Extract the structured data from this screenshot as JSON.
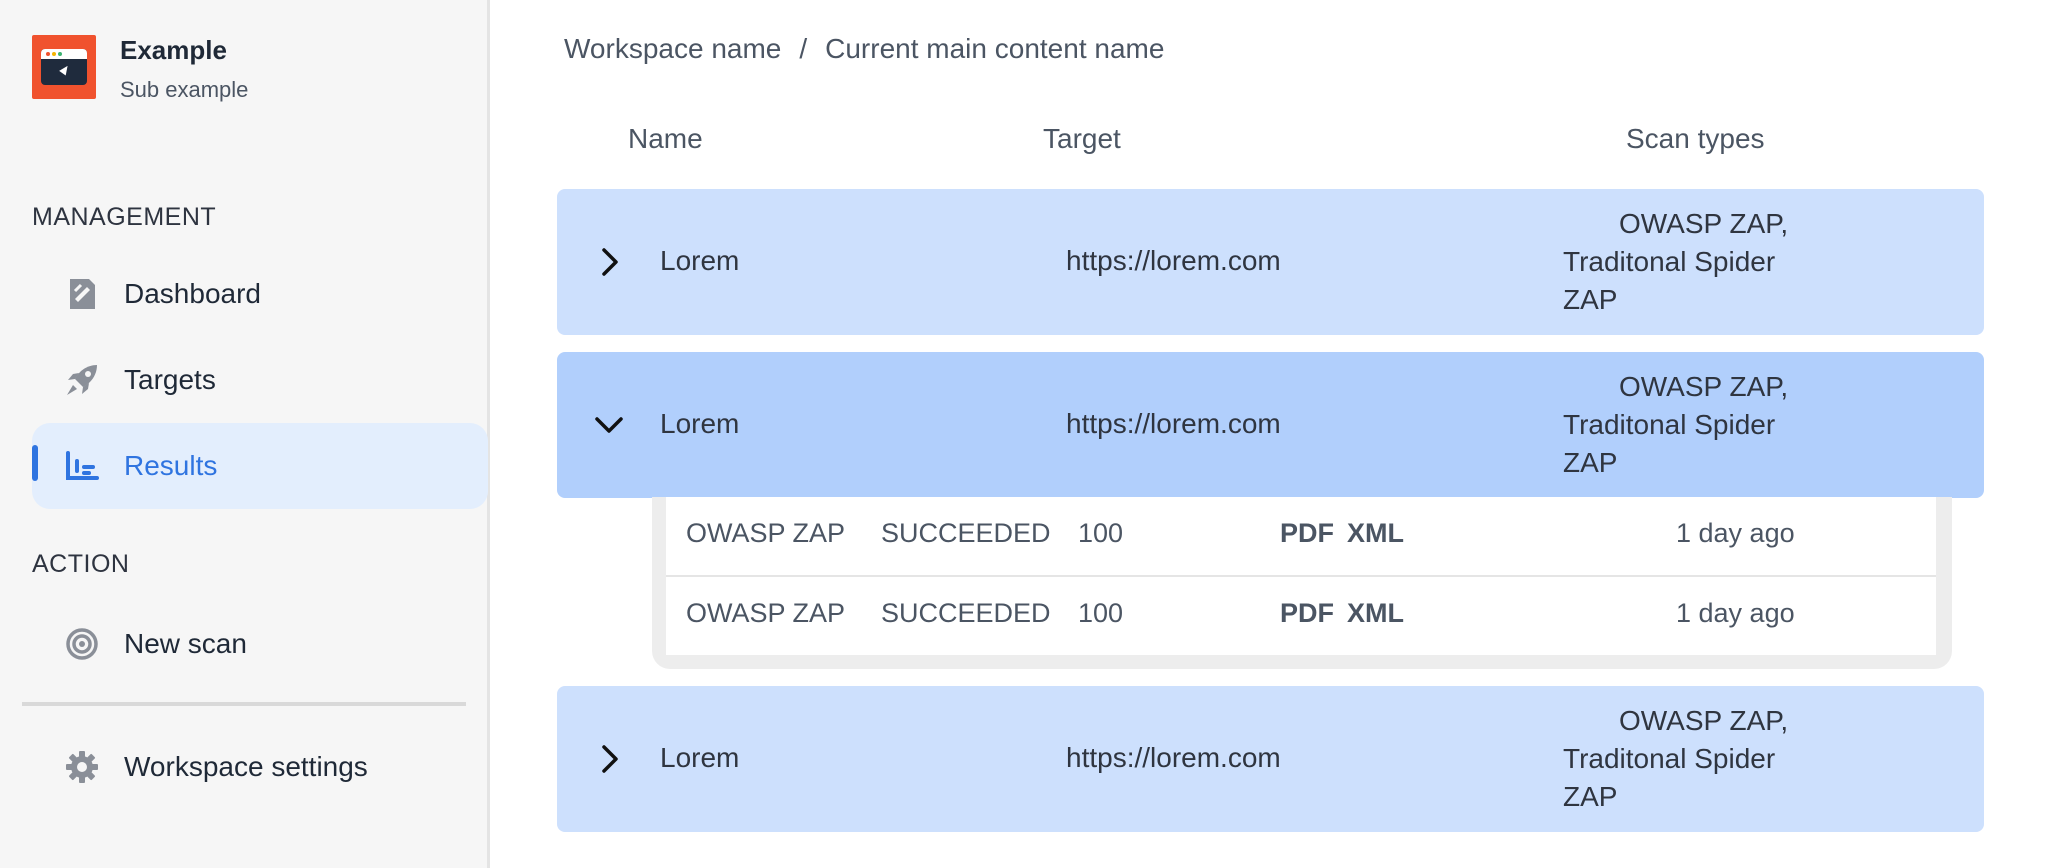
{
  "brand": {
    "title": "Example",
    "subtitle": "Sub example",
    "accent": "#f0522e"
  },
  "sidebar": {
    "management_label": "MANAGEMENT",
    "action_label": "ACTION",
    "items": [
      {
        "label": "Dashboard",
        "icon": "dashboard-icon"
      },
      {
        "label": "Targets",
        "icon": "rocket-icon"
      },
      {
        "label": "Results",
        "icon": "bar-chart-icon",
        "active": true
      },
      {
        "label": "New scan",
        "icon": "target-icon"
      },
      {
        "label": "Workspace settings",
        "icon": "gear-icon"
      }
    ]
  },
  "breadcrumb": {
    "workspace": "Workspace name",
    "separator": "/",
    "current": "Current main content name"
  },
  "table": {
    "headers": {
      "name": "Name",
      "target": "Target",
      "scan_types": "Scan types"
    },
    "rows": [
      {
        "name": "Lorem",
        "target": "https://lorem.com",
        "scan_types": [
          "OWASP ZAP,",
          "Traditonal Spider",
          "ZAP"
        ],
        "expanded": false
      },
      {
        "name": "Lorem",
        "target": "https://lorem.com",
        "scan_types": [
          "OWASP ZAP,",
          "Traditonal Spider",
          "ZAP"
        ],
        "expanded": true
      },
      {
        "name": "Lorem",
        "target": "https://lorem.com",
        "scan_types": [
          "OWASP ZAP,",
          "Traditonal Spider",
          "ZAP"
        ],
        "expanded": false
      }
    ],
    "sub_rows": [
      {
        "scanner": "OWASP ZAP",
        "status": "SUCCEEDED",
        "score": "100",
        "pdf": "PDF",
        "xml": "XML",
        "time": "1 day ago"
      },
      {
        "scanner": "OWASP ZAP",
        "status": "SUCCEEDED",
        "score": "100",
        "pdf": "PDF",
        "xml": "XML",
        "time": "1 day ago"
      }
    ]
  },
  "colors": {
    "row_bg": "#cde0fd",
    "row_expanded_bg": "#b1cffc",
    "active_nav": "#2f74e0"
  }
}
